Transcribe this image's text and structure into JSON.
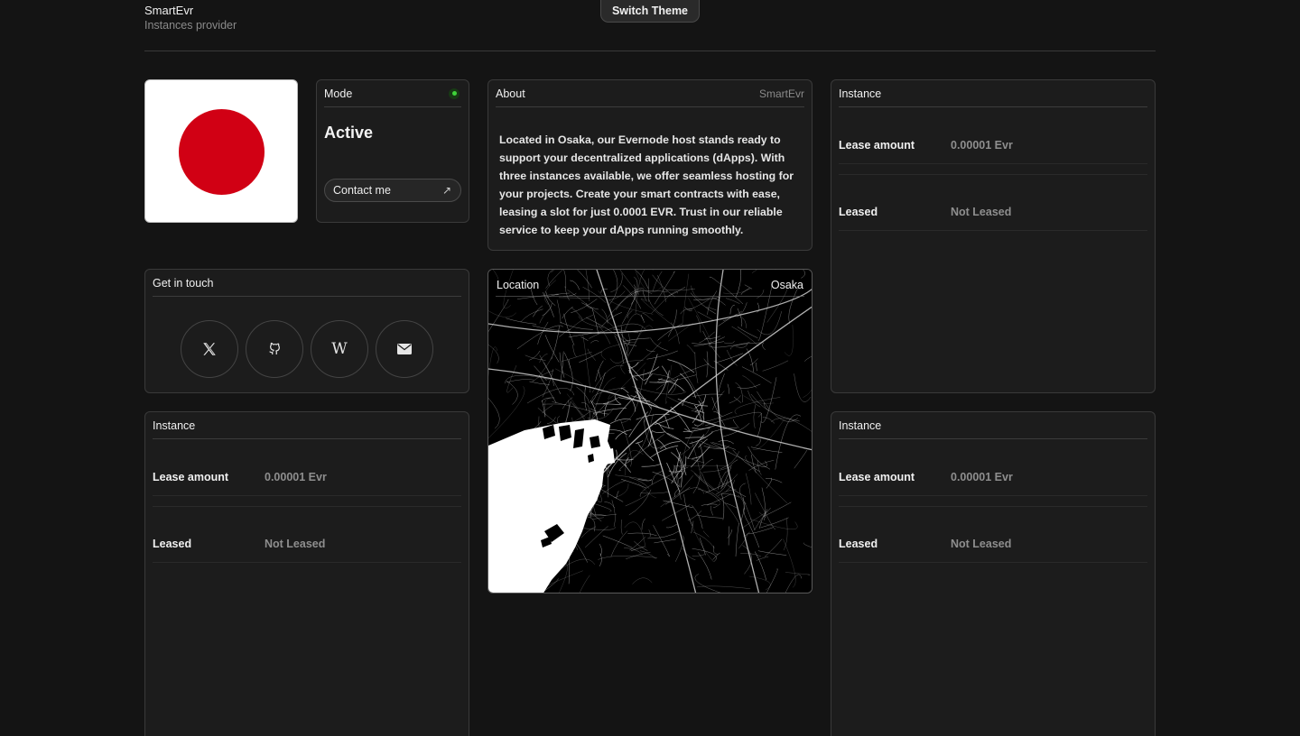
{
  "header": {
    "brand_title": "SmartEvr",
    "brand_subtitle": "Instances provider",
    "switch_theme_label": "Switch Theme"
  },
  "flag": {
    "country": "Japan",
    "sun_color": "#d10014"
  },
  "mode": {
    "title": "Mode",
    "value": "Active",
    "status_color": "#3fd43a",
    "contact_label": "Contact me"
  },
  "about": {
    "title": "About",
    "meta": "SmartEvr",
    "text": "Located in Osaka, our Evernode host stands ready to support your decentralized applications (dApps). With three instances available, we offer seamless hosting for your projects. Create your smart contracts with ease, leasing a slot for just 0.0001 EVR. Trust in our reliable service to keep your dApps running smoothly."
  },
  "get_in_touch": {
    "title": "Get in touch",
    "links": [
      {
        "icon": "x-icon"
      },
      {
        "icon": "github-icon"
      },
      {
        "icon": "wikipedia-icon"
      },
      {
        "icon": "mail-icon"
      }
    ]
  },
  "location": {
    "title": "Location",
    "city": "Osaka"
  },
  "instances": [
    {
      "title": "Instance",
      "lease_amount_label": "Lease amount",
      "lease_amount_value": "0.00001 Evr",
      "leased_label": "Leased",
      "leased_value": "Not Leased"
    },
    {
      "title": "Instance",
      "lease_amount_label": "Lease amount",
      "lease_amount_value": "0.00001 Evr",
      "leased_label": "Leased",
      "leased_value": "Not Leased"
    },
    {
      "title": "Instance",
      "lease_amount_label": "Lease amount",
      "lease_amount_value": "0.00001 Evr",
      "leased_label": "Leased",
      "leased_value": "Not Leased"
    }
  ]
}
